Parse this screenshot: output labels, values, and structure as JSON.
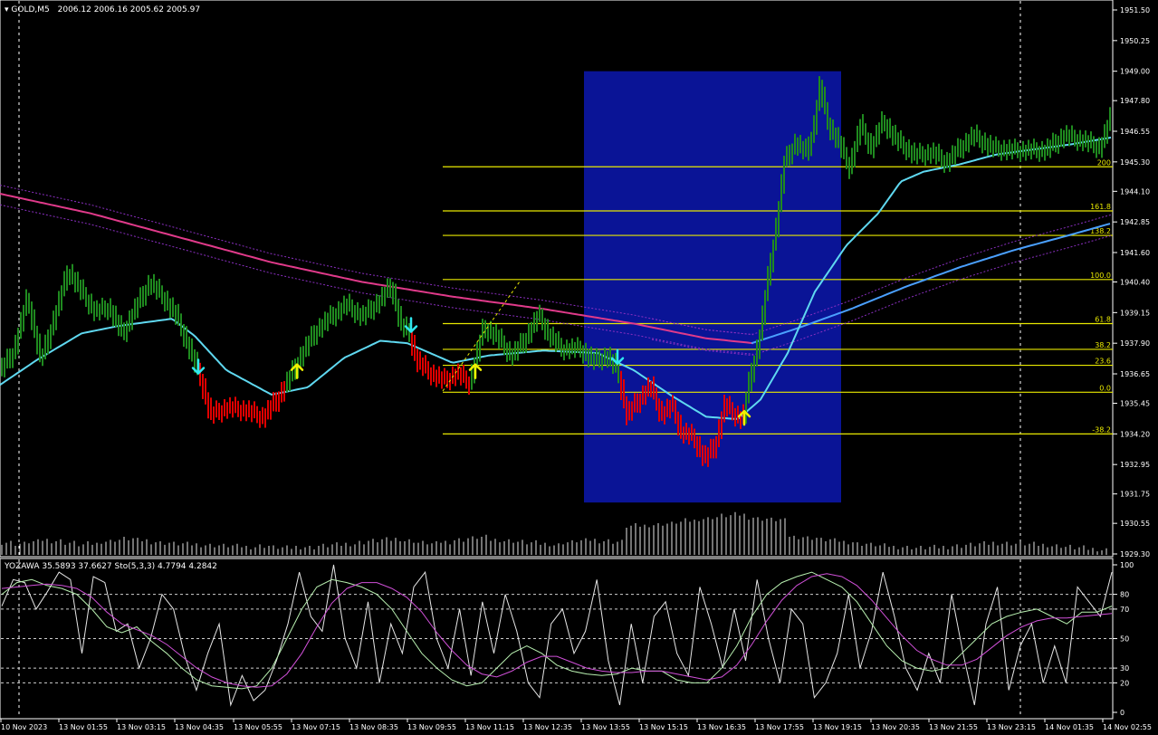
{
  "window": {
    "symbol": "GOLD,M5",
    "ohlc": "2006.12 2006.16 2005.62 2005.97"
  },
  "colors": {
    "background": "#000000",
    "frame": "#ffffff",
    "bull_bar": "#1f8a1f",
    "bear_bar": "#e00000",
    "ma_fast": "#5fd8f0",
    "ma_slow": "#4aa0ff",
    "ma_pink": "#e03a8a",
    "band": "#8a2fc0",
    "fib_line": "#e8e800",
    "highlight_box": "#0a1496",
    "arrow_up": "#f0f000",
    "arrow_down": "#30e8f0",
    "volume": "#e6e6e6",
    "stoch_white": "#e6e6e6",
    "stoch_green": "#b8f0b0",
    "stoch_magenta": "#d050d8"
  },
  "chart_data": [
    {
      "type": "candlestick",
      "title": "GOLD,M5",
      "y_ticks": [
        "1951.50",
        "1950.25",
        "1949.00",
        "1947.80",
        "1946.55",
        "1945.30",
        "1944.10",
        "1942.85",
        "1941.60",
        "1940.40",
        "1939.15",
        "1937.90",
        "1936.65",
        "1935.45",
        "1934.20",
        "1932.95",
        "1931.75",
        "1930.55",
        "1929.30"
      ],
      "ylim": [
        1929.3,
        1951.5
      ],
      "x_ticks": [
        "10 Nov 2023",
        "13 Nov 01:55",
        "13 Nov 03:15",
        "13 Nov 04:35",
        "13 Nov 05:55",
        "13 Nov 07:15",
        "13 Nov 08:35",
        "13 Nov 09:55",
        "13 Nov 11:15",
        "13 Nov 12:35",
        "13 Nov 13:55",
        "13 Nov 15:15",
        "13 Nov 16:35",
        "13 Nov 17:55",
        "13 Nov 19:15",
        "13 Nov 20:35",
        "13 Nov 21:55",
        "13 Nov 23:15",
        "14 Nov 01:35",
        "14 Nov 02:55"
      ],
      "price_path": [
        [
          0,
          1936.8
        ],
        [
          15,
          1937.6
        ],
        [
          30,
          1939.8
        ],
        [
          45,
          1937.2
        ],
        [
          60,
          1939.0
        ],
        [
          75,
          1940.9
        ],
        [
          90,
          1940.0
        ],
        [
          105,
          1939.2
        ],
        [
          120,
          1939.4
        ],
        [
          135,
          1938.3
        ],
        [
          150,
          1939.4
        ],
        [
          165,
          1940.4
        ],
        [
          180,
          1939.8
        ],
        [
          195,
          1939.0
        ],
        [
          210,
          1937.6
        ],
        [
          222,
          1936.4
        ],
        [
          232,
          1935.0
        ],
        [
          250,
          1935.3
        ],
        [
          270,
          1935.2
        ],
        [
          290,
          1934.9
        ],
        [
          305,
          1935.6
        ],
        [
          318,
          1936.4
        ],
        [
          332,
          1937.4
        ],
        [
          348,
          1938.4
        ],
        [
          365,
          1939.0
        ],
        [
          382,
          1939.5
        ],
        [
          400,
          1939.0
        ],
        [
          420,
          1939.7
        ],
        [
          432,
          1940.3
        ],
        [
          442,
          1938.7
        ],
        [
          452,
          1938.3
        ],
        [
          460,
          1937.2
        ],
        [
          475,
          1936.7
        ],
        [
          490,
          1936.4
        ],
        [
          505,
          1936.7
        ],
        [
          518,
          1936.3
        ],
        [
          526,
          1937.4
        ],
        [
          534,
          1938.6
        ],
        [
          548,
          1938.2
        ],
        [
          565,
          1937.4
        ],
        [
          580,
          1938.1
        ],
        [
          595,
          1939.1
        ],
        [
          605,
          1938.3
        ],
        [
          620,
          1937.7
        ],
        [
          640,
          1937.7
        ],
        [
          655,
          1937.2
        ],
        [
          670,
          1937.4
        ],
        [
          682,
          1936.8
        ],
        [
          692,
          1935.0
        ],
        [
          705,
          1935.6
        ],
        [
          718,
          1936.2
        ],
        [
          730,
          1935.0
        ],
        [
          742,
          1935.4
        ],
        [
          752,
          1934.3
        ],
        [
          765,
          1934.1
        ],
        [
          778,
          1933.2
        ],
        [
          790,
          1933.8
        ],
        [
          800,
          1935.4
        ],
        [
          812,
          1935.0
        ],
        [
          820,
          1934.8
        ],
        [
          828,
          1936.5
        ],
        [
          838,
          1938.0
        ],
        [
          848,
          1940.6
        ],
        [
          858,
          1942.9
        ],
        [
          866,
          1945.3
        ],
        [
          878,
          1946.1
        ],
        [
          890,
          1945.7
        ],
        [
          898,
          1946.6
        ],
        [
          905,
          1948.4
        ],
        [
          915,
          1946.8
        ],
        [
          925,
          1946.2
        ],
        [
          938,
          1945.1
        ],
        [
          950,
          1946.8
        ],
        [
          962,
          1945.9
        ],
        [
          975,
          1947.0
        ],
        [
          990,
          1946.2
        ],
        [
          1010,
          1945.6
        ],
        [
          1030,
          1945.7
        ],
        [
          1045,
          1945.3
        ],
        [
          1060,
          1945.9
        ],
        [
          1075,
          1946.4
        ],
        [
          1095,
          1945.9
        ],
        [
          1115,
          1945.8
        ],
        [
          1135,
          1945.8
        ],
        [
          1155,
          1945.8
        ],
        [
          1175,
          1946.4
        ],
        [
          1195,
          1946.2
        ],
        [
          1215,
          1945.9
        ],
        [
          1228,
          1947.3
        ]
      ],
      "ma_fast_path": [
        [
          0,
          1936.2
        ],
        [
          40,
          1937.2
        ],
        [
          90,
          1938.3
        ],
        [
          130,
          1938.6
        ],
        [
          190,
          1938.9
        ],
        [
          215,
          1938.2
        ],
        [
          250,
          1936.8
        ],
        [
          300,
          1935.8
        ],
        [
          340,
          1936.1
        ],
        [
          380,
          1937.3
        ],
        [
          420,
          1938.0
        ],
        [
          450,
          1937.9
        ],
        [
          500,
          1937.1
        ],
        [
          540,
          1937.4
        ],
        [
          600,
          1937.6
        ],
        [
          660,
          1937.5
        ],
        [
          700,
          1936.8
        ],
        [
          740,
          1935.8
        ],
        [
          780,
          1934.9
        ],
        [
          815,
          1934.8
        ],
        [
          840,
          1935.6
        ],
        [
          870,
          1937.5
        ],
        [
          900,
          1940.0
        ],
        [
          935,
          1941.9
        ],
        [
          970,
          1943.2
        ],
        [
          995,
          1944.5
        ],
        [
          1020,
          1944.9
        ],
        [
          1060,
          1945.2
        ],
        [
          1100,
          1945.6
        ],
        [
          1140,
          1945.8
        ],
        [
          1180,
          1946.0
        ],
        [
          1228,
          1946.3
        ]
      ],
      "ma_slow_path": [
        [
          830,
          1937.9
        ],
        [
          880,
          1938.5
        ],
        [
          940,
          1939.3
        ],
        [
          1000,
          1940.2
        ],
        [
          1060,
          1941.0
        ],
        [
          1120,
          1941.7
        ],
        [
          1180,
          1942.3
        ],
        [
          1228,
          1942.8
        ]
      ],
      "ma_pink_path": [
        [
          0,
          1944.0
        ],
        [
          100,
          1943.2
        ],
        [
          200,
          1942.2
        ],
        [
          300,
          1941.2
        ],
        [
          400,
          1940.4
        ],
        [
          500,
          1939.8
        ],
        [
          600,
          1939.3
        ],
        [
          700,
          1938.7
        ],
        [
          780,
          1938.1
        ],
        [
          832,
          1937.9
        ]
      ],
      "fibonacci": {
        "levels": [
          {
            "label": "200",
            "price": 1945.1
          },
          {
            "label": "161.8",
            "price": 1943.3
          },
          {
            "label": "138.2",
            "price": 1942.3
          },
          {
            "label": "100.0",
            "price": 1940.5
          },
          {
            "label": "61.8",
            "price": 1938.7
          },
          {
            "label": "38.2",
            "price": 1937.65
          },
          {
            "label": "23.6",
            "price": 1937.0
          },
          {
            "label": "0.0",
            "price": 1935.9
          },
          {
            "label": "-38.2",
            "price": 1934.2
          }
        ]
      },
      "highlight_range": {
        "price_high": 1949.0,
        "price_low": 1931.4
      },
      "signals": [
        {
          "dir": "down",
          "x": 219,
          "price": 1937.0
        },
        {
          "dir": "up",
          "x": 328,
          "price": 1936.7
        },
        {
          "dir": "down",
          "x": 454,
          "price": 1938.7
        },
        {
          "dir": "up",
          "x": 525,
          "price": 1936.7
        },
        {
          "dir": "down",
          "x": 682,
          "price": 1937.4
        },
        {
          "dir": "up",
          "x": 822,
          "price": 1934.8
        }
      ]
    },
    {
      "type": "line",
      "title": "YOZAWA 35.5893 37.6627  Sto(5,3,3) 4.7794 4.2842",
      "y_ticks": [
        "100",
        "80",
        "70",
        "50",
        "30",
        "20",
        "0"
      ],
      "ylim": [
        0,
        100
      ],
      "dashed_levels": [
        80,
        70,
        50,
        30,
        20
      ],
      "series": [
        {
          "name": "white",
          "values": [
            72,
            90,
            88,
            70,
            82,
            95,
            90,
            40,
            92,
            88,
            55,
            60,
            30,
            50,
            80,
            70,
            38,
            15,
            40,
            60,
            5,
            25,
            8,
            15,
            35,
            60,
            95,
            65,
            55,
            100,
            50,
            30,
            75,
            20,
            60,
            40,
            85,
            95,
            50,
            30,
            70,
            25,
            75,
            40,
            80,
            55,
            20,
            10,
            60,
            70,
            40,
            55,
            90,
            35,
            5,
            60,
            20,
            65,
            75,
            40,
            25,
            85,
            60,
            30,
            70,
            35,
            90,
            50,
            20,
            70,
            60,
            10,
            20,
            40,
            80,
            30,
            55,
            95,
            65,
            30,
            15,
            40,
            20,
            80,
            40,
            5,
            60,
            85,
            15,
            45,
            60,
            20,
            45,
            20,
            85,
            75,
            65,
            95
          ]
        },
        {
          "name": "green",
          "values": [
            80,
            88,
            90,
            86,
            84,
            80,
            70,
            58,
            54,
            58,
            48,
            40,
            30,
            22,
            18,
            17,
            16,
            18,
            30,
            50,
            70,
            85,
            90,
            88,
            85,
            80,
            70,
            55,
            40,
            30,
            22,
            18,
            20,
            30,
            40,
            45,
            40,
            32,
            28,
            26,
            25,
            26,
            30,
            28,
            28,
            22,
            20,
            20,
            30,
            45,
            65,
            80,
            88,
            92,
            95,
            90,
            85,
            75,
            60,
            45,
            35,
            30,
            28,
            30,
            40,
            50,
            60,
            65,
            68,
            70,
            65,
            60,
            68,
            68,
            72
          ]
        },
        {
          "name": "magenta",
          "values": [
            84,
            85,
            86,
            87,
            86,
            84,
            78,
            68,
            60,
            56,
            52,
            46,
            38,
            30,
            24,
            20,
            18,
            17,
            18,
            26,
            40,
            58,
            74,
            84,
            88,
            88,
            84,
            78,
            68,
            54,
            42,
            32,
            26,
            24,
            28,
            34,
            38,
            38,
            34,
            30,
            28,
            27,
            27,
            28,
            28,
            26,
            24,
            22,
            24,
            32,
            46,
            62,
            76,
            86,
            92,
            94,
            92,
            86,
            76,
            64,
            52,
            42,
            36,
            32,
            32,
            36,
            44,
            52,
            58,
            62,
            64,
            64,
            65,
            66,
            67
          ]
        }
      ]
    },
    {
      "type": "bar",
      "title": "",
      "values": [
        25,
        22,
        26,
        30,
        28,
        24,
        20,
        22,
        27,
        30,
        32,
        29,
        26,
        24,
        22,
        21,
        20,
        19,
        18,
        17,
        16,
        18,
        15,
        14,
        16,
        15,
        18,
        20,
        22,
        25,
        28,
        30,
        32,
        28,
        24,
        22,
        26,
        30,
        33,
        35,
        30,
        28,
        26,
        24,
        22,
        20,
        25,
        28,
        30,
        28,
        26,
        27,
        28,
        30,
        32,
        35,
        38,
        42,
        45,
        48,
        50,
        45,
        42,
        40,
        38,
        36,
        34,
        30,
        28,
        26,
        22,
        20,
        18,
        16,
        15,
        14,
        15,
        16,
        18,
        20,
        22,
        24,
        23,
        22,
        21,
        20,
        18,
        16,
        14,
        12,
        10
      ]
    }
  ]
}
